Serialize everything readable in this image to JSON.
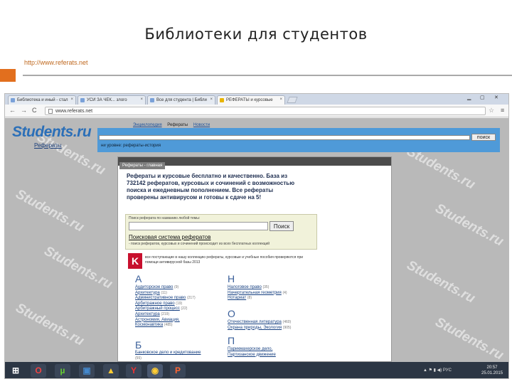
{
  "slide": {
    "title": "Библиотеки для студентов",
    "link": "http://www.referats.net"
  },
  "browser": {
    "tabs": [
      {
        "label": "Библиотека и иный - стал"
      },
      {
        "label": "УСИ ЗА ЧЕК... злого"
      },
      {
        "label": "Все для студента | Библи"
      },
      {
        "label": "РЕФЕРАТЫ и курсовые"
      }
    ],
    "address": "www.referats.net"
  },
  "site": {
    "logo": "Students.ru",
    "logo_sub": "Рефераты",
    "topnav": [
      "Энциклопедия",
      "Рефераты",
      "Новости"
    ],
    "search_button": "поиск",
    "subnav": "ни уровне: рефераты-история",
    "content_tab": "Рефераты - главная",
    "intro": "Рефераты и курсовые бесплатно и качественно. База из 732142 рефератов, курсовых и сочинений с возможностью поиска и ежедневным пополнением. Все рефераты проверены антивирусом и готовы к сдаче на 5!",
    "search_label": "Поиск реферата по названию любой темы:",
    "search_button_main": "Поиск",
    "search_title": "Поисковая система рефератов",
    "search_desc": "- поиск рефератов, курсовых и сочинений происходит из всех бесплатных коллекций",
    "kaspersky_logo": "K",
    "kaspersky_text": "все поступающие в нашу коллекцию рефераты, курсовые и учебные пособия проверяются при помощи антивирусной базы 2013",
    "letter_a": "А",
    "letter_b": "Б",
    "letter_n": "Н",
    "letter_o": "О",
    "letter_p": "П",
    "col1": [
      {
        "t": "Аудиторское право",
        "n": "(9)"
      },
      {
        "t": "Архитектура",
        "n": "(11)"
      },
      {
        "t": "Административное право",
        "n": "(217)"
      },
      {
        "t": "Арбитражное право",
        "n": "(19)"
      },
      {
        "t": "Арбитражный процесс",
        "n": "(22)"
      },
      {
        "t": "Архитектура",
        "n": "(219)"
      },
      {
        "t": "Астрономия, Авиация,",
        "n": ""
      },
      {
        "t": "Космонавтика",
        "n": "(485)"
      }
    ],
    "col1b": [
      {
        "t": "Банковское дело и кредитование",
        "n": ""
      },
      {
        "t": "",
        "n": "(55)"
      }
    ],
    "col2": [
      {
        "t": "Налоговое право",
        "n": "(35)"
      },
      {
        "t": "Начертательная геометрия",
        "n": "(4)"
      },
      {
        "t": "Нотариат",
        "n": "(8)"
      }
    ],
    "col2b": [
      {
        "t": "Отечественная литература",
        "n": "(460)"
      },
      {
        "t": "Охрана природы, Экология",
        "n": "(905)"
      }
    ],
    "col2c": [
      {
        "t": "Парикмахерское дело,",
        "n": ""
      },
      {
        "t": "Партизанское движение",
        "n": ""
      }
    ]
  },
  "taskbar": {
    "tray": "▲ ⚑ ▮ ◀) РУС",
    "time": "20:57",
    "date": "25.01.2015"
  }
}
